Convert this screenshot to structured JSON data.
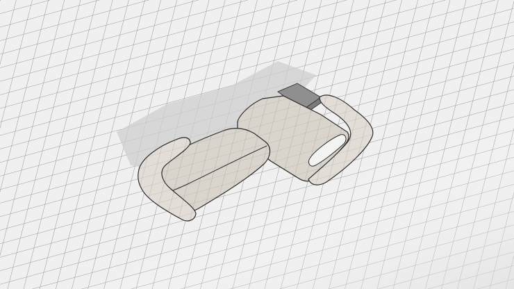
{
  "scene": {
    "object": "sectional-sofa",
    "view": "isometric-wireframe",
    "colors": {
      "floor": "#f0f0f0",
      "grid": "#8d8d8d",
      "shadow": "#d0d0d0",
      "upholstery": "#d9d4cc",
      "upholstery_dark": "#c7c1b8",
      "upholstery_light": "#e4e0d9",
      "outline": "#2a2a2a",
      "pillow": "#f3f3f1",
      "side_table": "#9a9a9a"
    }
  }
}
